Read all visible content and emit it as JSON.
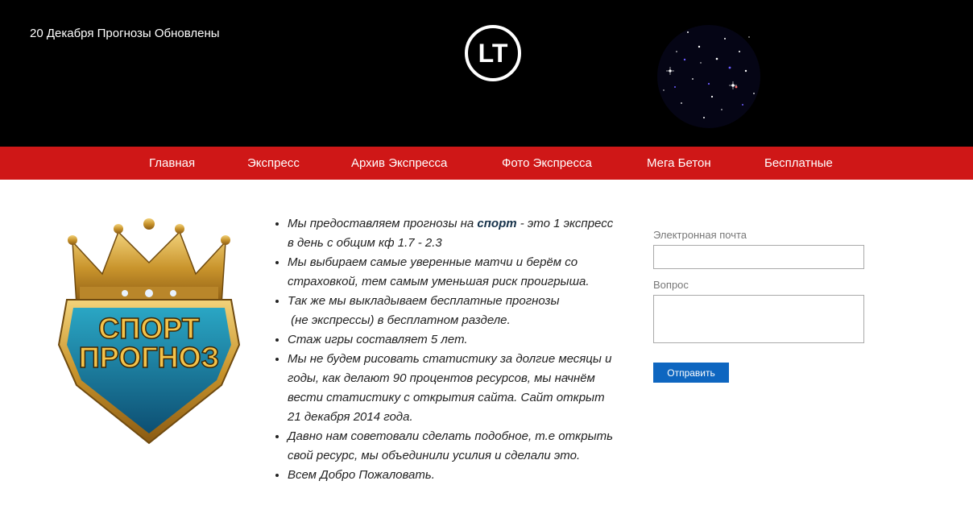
{
  "header": {
    "notice": "20 Декабря Прогнозы Обновлены",
    "logo_text": "LT"
  },
  "nav": {
    "items": [
      {
        "label": "Главная"
      },
      {
        "label": "Экспресс"
      },
      {
        "label": "Архив Экспресса"
      },
      {
        "label": "Фото Экспресса"
      },
      {
        "label": "Мега Бетон"
      },
      {
        "label": "Бесплатные"
      }
    ]
  },
  "badge": {
    "line1": "СПОРТ",
    "line2": "ПРОГНОЗ"
  },
  "content": {
    "item0": {
      "a": "Мы предоставляем прогнозы на ",
      "b": "спорт",
      "c": " - это 1 экспресс",
      "d": "в день  с общим кф 1.7 - 2.3"
    },
    "item1": {
      "a": "Мы выбираем самые уверенные матчи и берём со",
      "b": "страховкой, тем самым уменьшая риск проигрыша."
    },
    "item2": {
      "a": "Так же мы выкладываем бесплатные прогнозы",
      "b": " (не экспрессы) в бесплатном разделе."
    },
    "item3": {
      "a": "Стаж игры  составляет 5 лет."
    },
    "item4": {
      "a": "Мы не будем рисовать статистику за долгие месяцы и",
      "b": "годы, как делают 90 процентов ресурсов, мы начнём",
      "c": "вести статистику с открытия сайта. Сайт открыт",
      "d": "21 декабря 2014 года."
    },
    "item5": {
      "a": "Давно нам советовали сделать подобное, т.е открыть",
      "b": "свой ресурс, мы объединили усилия и сделали это."
    },
    "item6": {
      "a": "Всем Добро Пожаловать."
    }
  },
  "form": {
    "email_label": "Электронная почта",
    "email_value": "",
    "question_label": "Вопрос",
    "question_value": "",
    "submit_label": "Отправить"
  },
  "colors": {
    "header_bg": "#000000",
    "nav_bg": "#cf1717",
    "submit_bg": "#0e66c0"
  }
}
